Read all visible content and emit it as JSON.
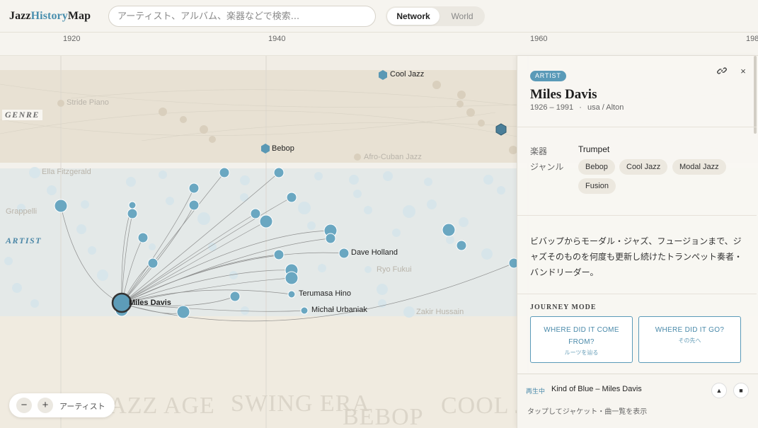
{
  "header": {
    "logo_part1": "Jazz",
    "logo_part2": "History",
    "logo_part3": "Map",
    "search_placeholder": "アーティスト、アルバム、楽器などで検索...",
    "view_options": [
      "Network",
      "World"
    ],
    "active_view": "Network"
  },
  "timeline": {
    "years": [
      "1920",
      "1940",
      "1960",
      "198"
    ]
  },
  "map": {
    "band_genre": "GENRE",
    "band_artist": "ARTIST",
    "era_labels": [
      "JAZZ AGE",
      "SWING ERA",
      "BEBOP",
      "COOL JAZZ"
    ],
    "genre_labels": {
      "cool_jazz": "Cool Jazz",
      "bebop": "Bebop",
      "stride_piano": "Stride Piano",
      "afro_cuban": "Afro-Cuban Jazz"
    },
    "artist_labels": {
      "miles": "Miles Davis",
      "dave_holland": "Dave Holland",
      "hino": "Terumasa Hino",
      "urbaniak": "Michał Urbaniak",
      "fitzgerald": "Ella Fitzgerald",
      "grappelli": "Grappelli",
      "fukui": "Ryo Fukui",
      "hussain": "Zakir Hussain"
    }
  },
  "zoom": {
    "minus": "−",
    "plus": "+",
    "label": "アーティスト"
  },
  "panel": {
    "badge": "ARTIST",
    "name": "Miles Davis",
    "years": "1926 – 1991",
    "origin": "usa / Alton",
    "instrument_label": "楽器",
    "instrument": "Trumpet",
    "genre_label": "ジャンル",
    "genres": [
      "Bebop",
      "Cool Jazz",
      "Modal Jazz",
      "Fusion"
    ],
    "description": "ビバップからモーダル・ジャズ、フュージョンまで、ジャズそのものを何度も更新し続けたトランペット奏者・バンドリーダー。",
    "journey_title": "JOURNEY MODE",
    "journey_from": {
      "main": "WHERE DID IT COME FROM?",
      "sub": "ルーツを辿る"
    },
    "journey_to": {
      "main": "WHERE DID IT GO?",
      "sub": "その先へ"
    },
    "link_icon": "link-icon",
    "close_icon": "×"
  },
  "player": {
    "status": "再生中",
    "track": "Kind of Blue – Miles Davis",
    "hint": "タップしてジャケット・曲一覧を表示",
    "up_icon": "▲",
    "stop_icon": "■"
  },
  "colors": {
    "accent": "#4a8fae",
    "node": "#6ba9c3",
    "genre_band": "#e9e3d6",
    "artist_band": "#e3e9e8"
  }
}
